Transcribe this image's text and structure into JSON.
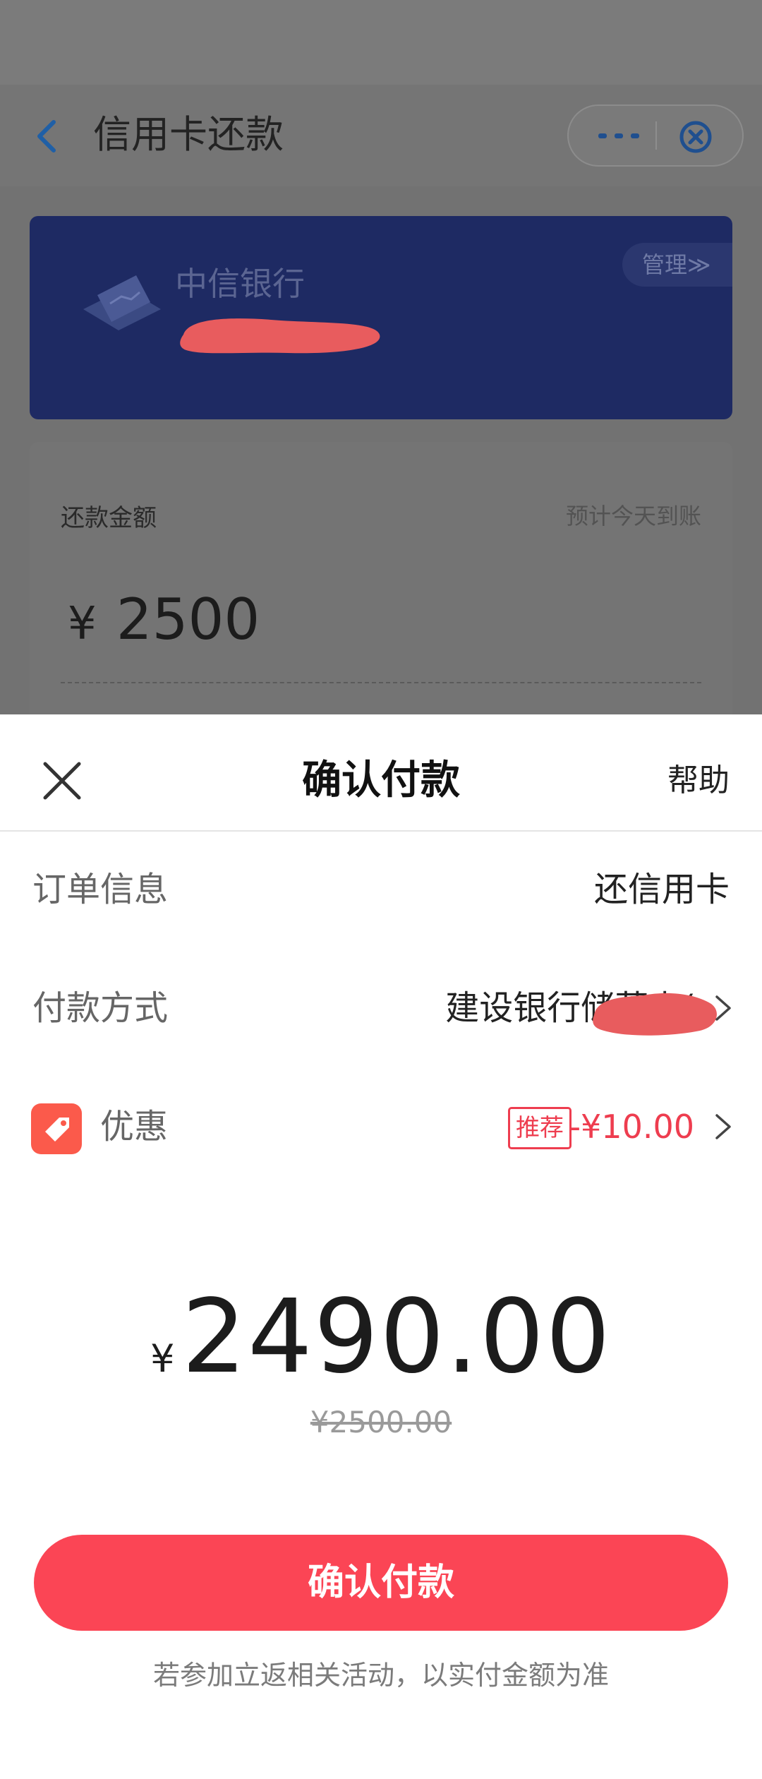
{
  "background_page": {
    "nav": {
      "title": "信用卡还款"
    },
    "card": {
      "bank_name": "中信银行",
      "manage_label": "管理≫"
    },
    "amount": {
      "label": "还款金额",
      "arrival_note": "预计今天到账",
      "currency": "¥",
      "value": "2500"
    }
  },
  "sheet": {
    "title": "确认付款",
    "help_label": "帮助",
    "order_info": {
      "label": "订单信息",
      "value": "还信用卡"
    },
    "payment_method": {
      "label": "付款方式",
      "value": "建设银行储蓄卡("
    },
    "coupon": {
      "label": "优惠",
      "badge": "推荐",
      "discount": "-¥10.00"
    },
    "total": {
      "currency": "¥",
      "amount": "2490.00",
      "original": "¥2500.00"
    },
    "confirm_label": "确认付款",
    "footnote": "若参加立返相关活动，以实付金额为准"
  },
  "colors": {
    "accent_red": "#fb4555",
    "discount_red": "#ee3d4f",
    "card_blue_dimmed": "#1e2a63",
    "overlay_gray": "#7a7a7a"
  },
  "icons": [
    "back-arrow-icon",
    "more-dots-icon",
    "close-miniapp-icon",
    "bank-card-icon",
    "close-icon",
    "chevron-right-icon",
    "coupon-tag-icon"
  ]
}
